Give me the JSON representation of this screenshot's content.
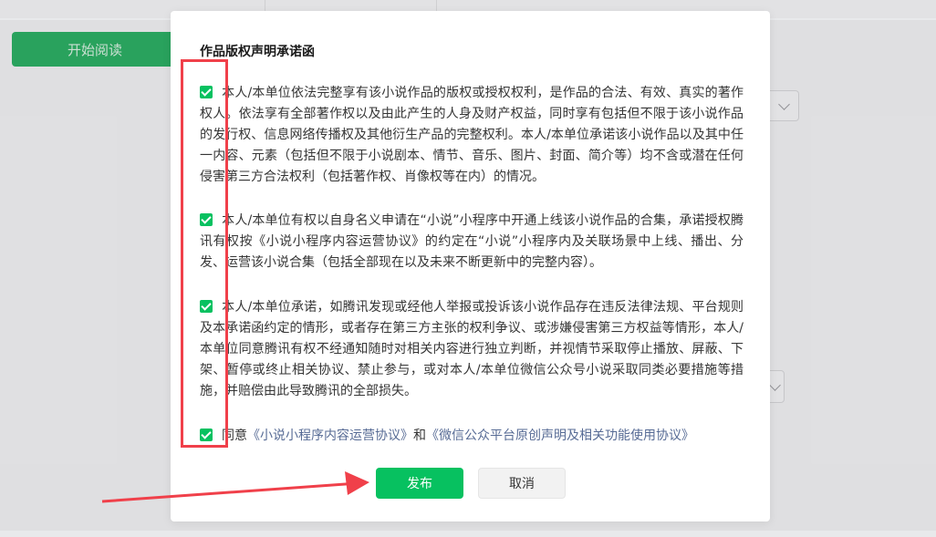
{
  "background": {
    "start_button_label": "开始阅读"
  },
  "dialog": {
    "title": "作品版权声明承诺函",
    "clauses": [
      {
        "text": "本人/本单位依法完整享有该小说作品的版权或授权权利，是作品的合法、有效、真实的著作权人。依法享有全部著作权以及由此产生的人身及财产权益，同时享有包括但不限于该小说作品的发行权、信息网络传播权及其他衍生产品的完整权利。本人/本单位承诺该小说作品以及其中任一内容、元素（包括但不限于小说剧本、情节、音乐、图片、封面、简介等）均不含或潜在任何侵害第三方合法权利（包括著作权、肖像权等在内）的情况。",
        "checked": true
      },
      {
        "text": "本人/本单位有权以自身名义申请在“小说”小程序中开通上线该小说作品的合集，承诺授权腾讯有权按《小说小程序内容运营协议》的约定在“小说”小程序内及关联场景中上线、播出、分发、运营该小说合集（包括全部现在以及未来不断更新中的完整内容）。",
        "checked": true
      },
      {
        "text": "本人/本单位承诺，如腾讯发现或经他人举报或投诉该小说作品存在违反法律法规、平台规则及本承诺函约定的情形，或者存在第三方主张的权利争议、或涉嫌侵害第三方权益等情形，本人/本单位同意腾讯有权不经通知随时对相关内容进行独立判断，并视情节采取停止播放、屏蔽、下架、暂停或终止相关协议、禁止参与，或对本人/本单位微信公众号小说采取同类必要措施等措施，并赔偿由此导致腾讯的全部损失。",
        "checked": true
      }
    ],
    "agreement": {
      "checked": true,
      "prefix": "同意",
      "link1": "《小说小程序内容运营协议》",
      "connector": "和",
      "link2": "《微信公众平台原创声明及相关功能使用协议》"
    },
    "publish_label": "发布",
    "cancel_label": "取消"
  },
  "colors": {
    "accent": "#07c160",
    "link": "#576b95",
    "annotation": "#f0404a"
  }
}
